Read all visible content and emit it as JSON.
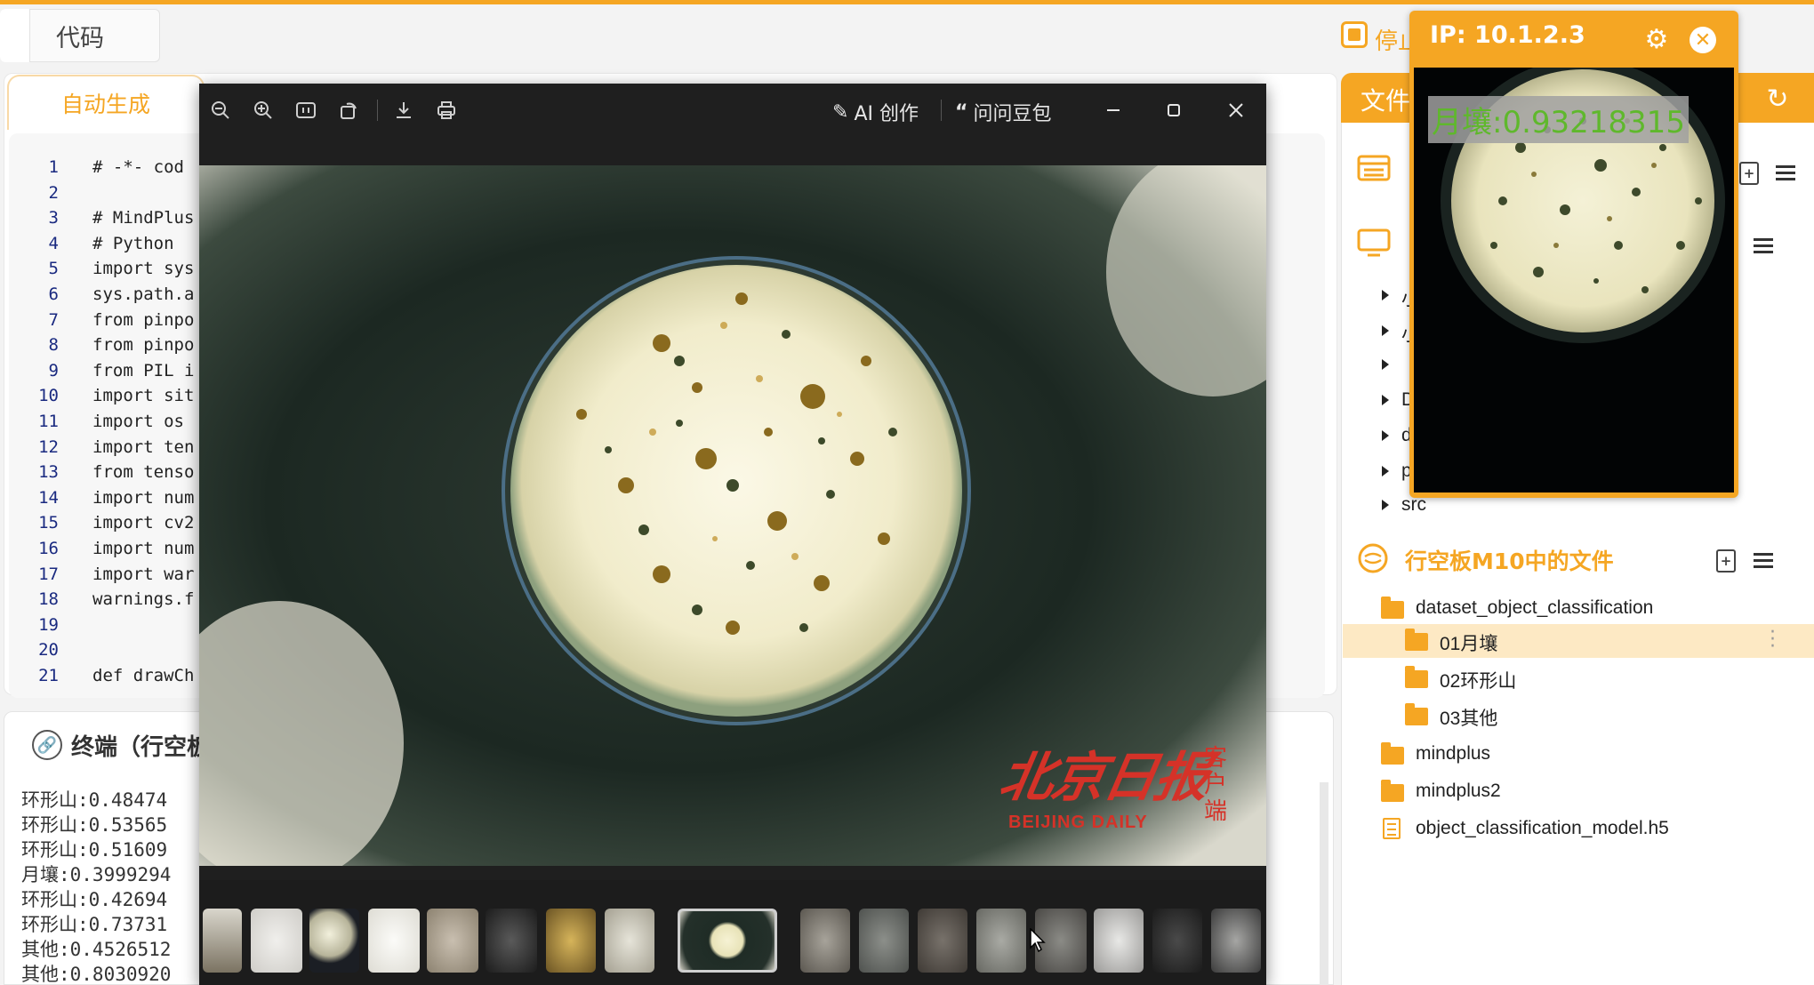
{
  "tabs": {
    "code": "代码",
    "auto_generate": "自动生成"
  },
  "editor": {
    "lines": [
      {
        "n": "1",
        "text": "# -*- cod"
      },
      {
        "n": "2",
        "text": ""
      },
      {
        "n": "3",
        "text": "# MindPlus"
      },
      {
        "n": "4",
        "text": "# Python"
      },
      {
        "n": "5",
        "text": "import sys"
      },
      {
        "n": "6",
        "text": "sys.path.a"
      },
      {
        "n": "7",
        "text": "from pinpo"
      },
      {
        "n": "8",
        "text": "from pinpo"
      },
      {
        "n": "9",
        "text": "from PIL i"
      },
      {
        "n": "10",
        "text": "import sit"
      },
      {
        "n": "11",
        "text": "import os"
      },
      {
        "n": "12",
        "text": "import ten"
      },
      {
        "n": "13",
        "text": "from tenso"
      },
      {
        "n": "14",
        "text": "import num"
      },
      {
        "n": "15",
        "text": "import cv2"
      },
      {
        "n": "16",
        "text": "import num"
      },
      {
        "n": "17",
        "text": "import war"
      },
      {
        "n": "18",
        "text": "warnings.f"
      },
      {
        "n": "19",
        "text": ""
      },
      {
        "n": "20",
        "text": ""
      },
      {
        "n": "21",
        "text": "def drawCh"
      }
    ]
  },
  "terminal": {
    "title": "终端（行空板",
    "lines": [
      "环形山:0.48474",
      "环形山:0.53565",
      "环形山:0.51609",
      "月壤:0.3999294",
      "环形山:0.42694",
      "环形山:0.73731",
      "其他:0.4526512",
      "其他:0.8030920"
    ]
  },
  "run_control": {
    "stop_label": "停止"
  },
  "camera_window": {
    "ip_label": "IP: 10.1.2.3",
    "prediction": "月壤:0.93218315"
  },
  "viewer": {
    "ai_create": "AI 创作",
    "ask_doubao": "问问豆包",
    "watermark_cn": "北京日报",
    "watermark_en": "BEIJING DAILY",
    "watermark_client": "客户端"
  },
  "file_panel": {
    "header": "文件",
    "local_tree": [
      {
        "label": "小",
        "expandable": true
      },
      {
        "label": "小",
        "expandable": true
      },
      {
        "label": "",
        "expandable": true
      },
      {
        "label": "D",
        "expandable": true
      },
      {
        "label": "d",
        "expandable": true
      },
      {
        "label": "p",
        "expandable": true
      },
      {
        "label": "src",
        "expandable": true
      }
    ],
    "board_section_title": "行空板M10中的文件",
    "board_tree": [
      {
        "label": "dataset_object_classification",
        "kind": "folder",
        "level": 0
      },
      {
        "label": "01月壤",
        "kind": "folder",
        "level": 1,
        "selected": true
      },
      {
        "label": "02环形山",
        "kind": "folder",
        "level": 1
      },
      {
        "label": "03其他",
        "kind": "folder",
        "level": 1
      },
      {
        "label": "mindplus",
        "kind": "folder",
        "level": 0
      },
      {
        "label": "mindplus2",
        "kind": "folder",
        "level": 0
      },
      {
        "label": "object_classification_model.h5",
        "kind": "file",
        "level": 0
      }
    ]
  },
  "colors": {
    "accent": "#f5a623",
    "selected_row": "#fde9c4",
    "watermark": "#d53228",
    "prediction_text": "#5fb82c"
  },
  "icons": [
    "zoom-out-icon",
    "zoom-in-icon",
    "fit-icon",
    "rotate-icon",
    "download-icon",
    "print-icon",
    "minimize-icon",
    "maximize-icon",
    "close-icon",
    "gear-icon",
    "refresh-icon",
    "link-icon"
  ]
}
